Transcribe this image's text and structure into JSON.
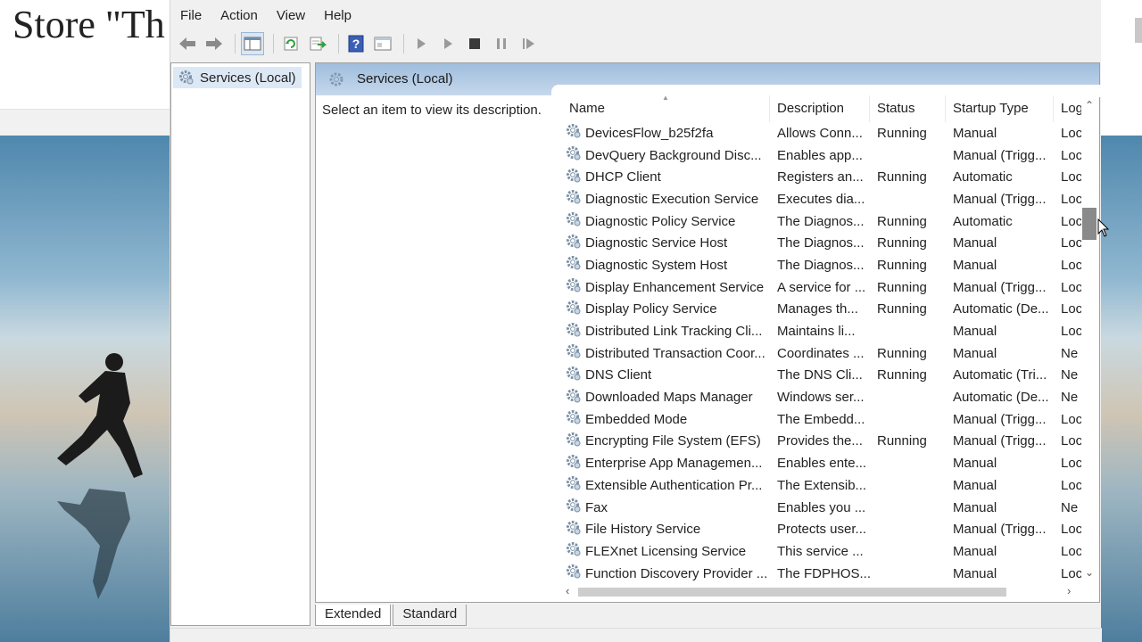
{
  "background_doc": {
    "title_fragment": "Store \"Th"
  },
  "window": {
    "menu": [
      "File",
      "Action",
      "View",
      "Help"
    ],
    "toolbar_icons": [
      "back-arrow-icon",
      "forward-arrow-icon",
      "show-hide-console-tree-icon",
      "refresh-icon",
      "export-list-icon",
      "help-icon",
      "properties-icon",
      "start-service-icon",
      "start-icon",
      "stop-service-icon",
      "pause-service-icon",
      "restart-service-icon"
    ],
    "tree": {
      "selected_item": "Services (Local)"
    },
    "pane": {
      "header_title": "Services (Local)",
      "description_prompt": "Select an item to view its description."
    },
    "table": {
      "columns": [
        "Name",
        "Description",
        "Status",
        "Startup Type",
        "Log"
      ],
      "rows": [
        {
          "name": "DevicesFlow_b25f2fa",
          "desc": "Allows Conn...",
          "status": "Running",
          "startup": "Manual",
          "log": "Loc"
        },
        {
          "name": "DevQuery Background Disc...",
          "desc": "Enables app...",
          "status": "",
          "startup": "Manual (Trigg...",
          "log": "Loc"
        },
        {
          "name": "DHCP Client",
          "desc": "Registers an...",
          "status": "Running",
          "startup": "Automatic",
          "log": "Loc"
        },
        {
          "name": "Diagnostic Execution Service",
          "desc": "Executes dia...",
          "status": "",
          "startup": "Manual (Trigg...",
          "log": "Loc"
        },
        {
          "name": "Diagnostic Policy Service",
          "desc": "The Diagnos...",
          "status": "Running",
          "startup": "Automatic",
          "log": "Loc"
        },
        {
          "name": "Diagnostic Service Host",
          "desc": "The Diagnos...",
          "status": "Running",
          "startup": "Manual",
          "log": "Loc"
        },
        {
          "name": "Diagnostic System Host",
          "desc": "The Diagnos...",
          "status": "Running",
          "startup": "Manual",
          "log": "Loc"
        },
        {
          "name": "Display Enhancement Service",
          "desc": "A service for ...",
          "status": "Running",
          "startup": "Manual (Trigg...",
          "log": "Loc"
        },
        {
          "name": "Display Policy Service",
          "desc": "Manages th...",
          "status": "Running",
          "startup": "Automatic (De...",
          "log": "Loc"
        },
        {
          "name": "Distributed Link Tracking Cli...",
          "desc": "Maintains li...",
          "status": "",
          "startup": "Manual",
          "log": "Loc"
        },
        {
          "name": "Distributed Transaction Coor...",
          "desc": "Coordinates ...",
          "status": "Running",
          "startup": "Manual",
          "log": "Ne"
        },
        {
          "name": "DNS Client",
          "desc": "The DNS Cli...",
          "status": "Running",
          "startup": "Automatic (Tri...",
          "log": "Ne"
        },
        {
          "name": "Downloaded Maps Manager",
          "desc": "Windows ser...",
          "status": "",
          "startup": "Automatic (De...",
          "log": "Ne"
        },
        {
          "name": "Embedded Mode",
          "desc": "The Embedd...",
          "status": "",
          "startup": "Manual (Trigg...",
          "log": "Loc"
        },
        {
          "name": "Encrypting File System (EFS)",
          "desc": "Provides the...",
          "status": "Running",
          "startup": "Manual (Trigg...",
          "log": "Loc"
        },
        {
          "name": "Enterprise App Managemen...",
          "desc": "Enables ente...",
          "status": "",
          "startup": "Manual",
          "log": "Loc"
        },
        {
          "name": "Extensible Authentication Pr...",
          "desc": "The Extensib...",
          "status": "",
          "startup": "Manual",
          "log": "Loc"
        },
        {
          "name": "Fax",
          "desc": "Enables you ...",
          "status": "",
          "startup": "Manual",
          "log": "Ne"
        },
        {
          "name": "File History Service",
          "desc": "Protects user...",
          "status": "",
          "startup": "Manual (Trigg...",
          "log": "Loc"
        },
        {
          "name": "FLEXnet Licensing Service",
          "desc": "This service ...",
          "status": "",
          "startup": "Manual",
          "log": "Loc"
        },
        {
          "name": "Function Discovery Provider ...",
          "desc": "The FDPHOS...",
          "status": "",
          "startup": "Manual",
          "log": "Loc"
        }
      ]
    },
    "tabs": [
      "Extended",
      "Standard"
    ],
    "active_tab": "Extended"
  }
}
